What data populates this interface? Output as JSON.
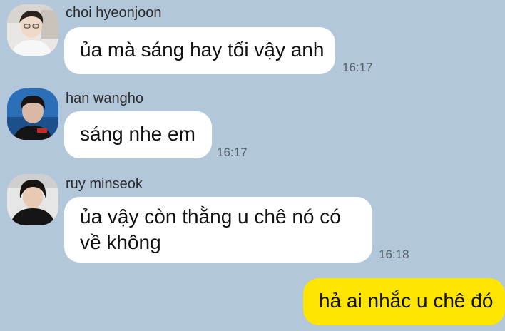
{
  "chat": {
    "background_color": "#b2c7da",
    "my_bubble_color": "#fee500",
    "messages": [
      {
        "sender": "choi hyeonjoon",
        "text": "ủa mà sáng hay tối vậy anh",
        "time": "16:17"
      },
      {
        "sender": "han wangho",
        "text": "sáng nhe em",
        "time": "16:17"
      },
      {
        "sender": "ruy minseok",
        "text": "ủa vậy còn thằng u chê nó có về không",
        "time": "16:18"
      }
    ],
    "outgoing": {
      "text": "hả ai nhắc u chê đó"
    }
  }
}
